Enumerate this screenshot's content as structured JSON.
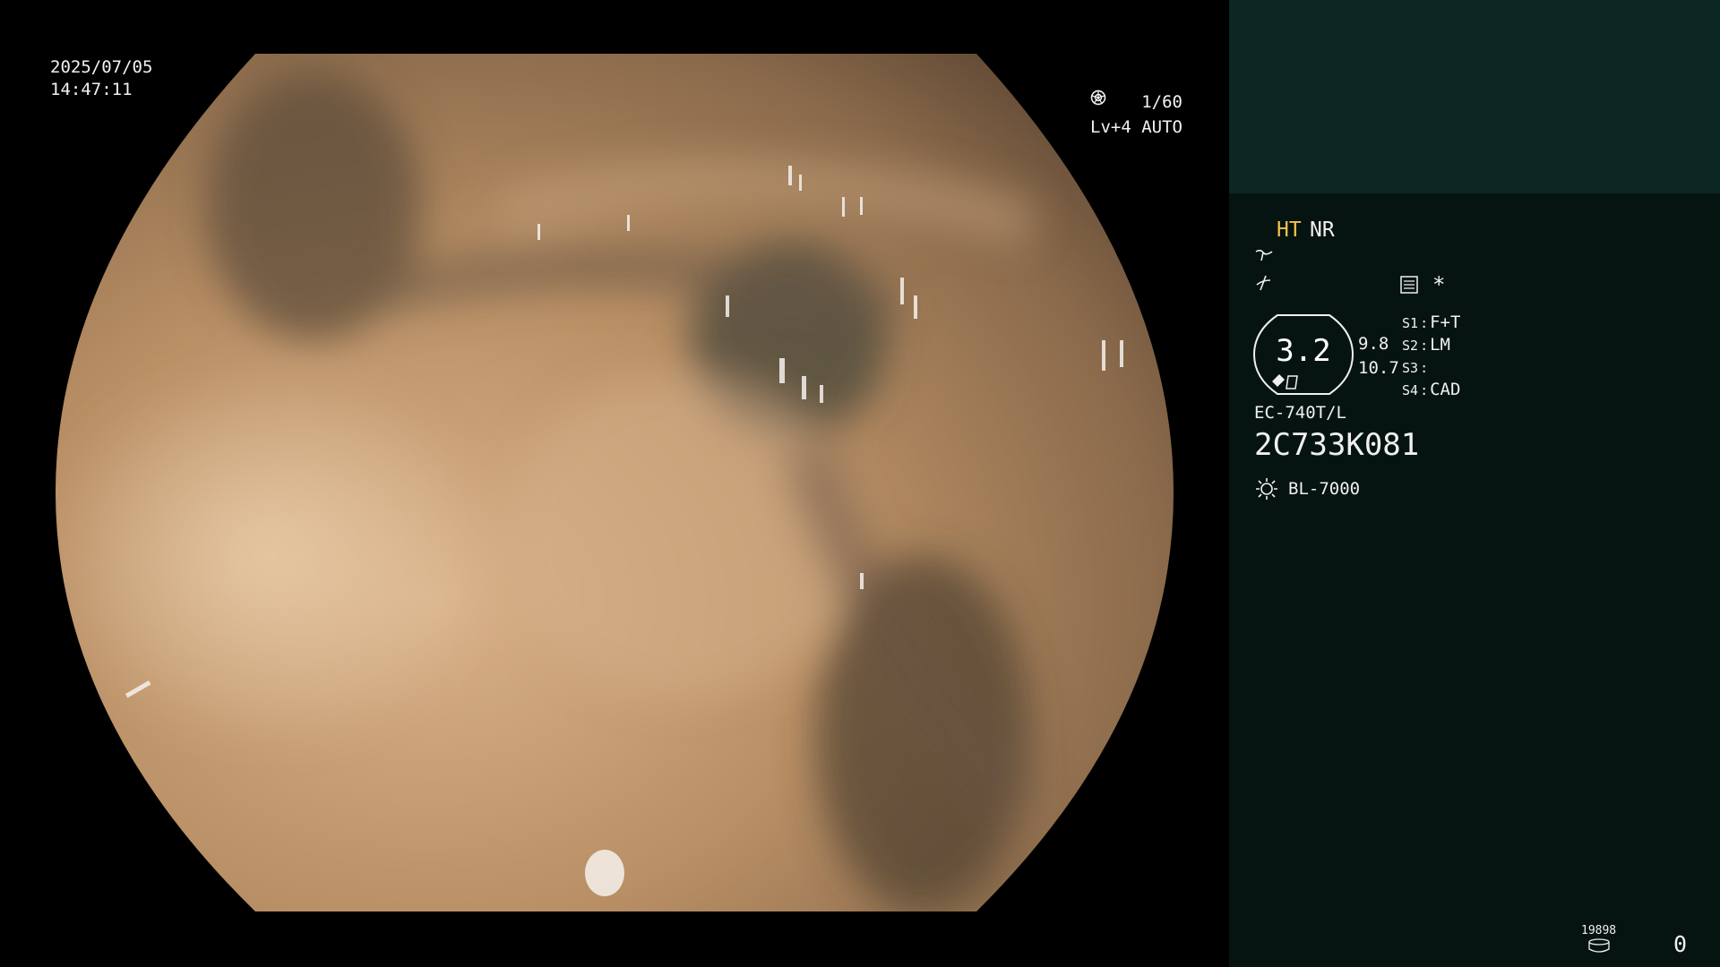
{
  "overlay": {
    "date": "2025/07/05",
    "time": "14:47:11",
    "shutter": "1/60",
    "shutter_icon": "shutter-icon",
    "iris": "Lv+4 AUTO",
    "iris_icon": "auto-iris-icon"
  },
  "panel": {
    "ht": "HT",
    "nr": "NR",
    "ht_color": "#f5c24a",
    "asterisk": "*",
    "zoom": {
      "value": "3.2",
      "scale_a": "9.8",
      "scale_b": "10.7"
    },
    "switches": [
      {
        "key": "S1",
        "value": "F+T"
      },
      {
        "key": "S2",
        "value": "LM"
      },
      {
        "key": "S3",
        "value": ""
      },
      {
        "key": "S4",
        "value": "CAD"
      }
    ],
    "scope_model": "EC-740T/L",
    "serial": "2C733K081",
    "light_source": "BL-7000",
    "light_icon": "light-source-icon",
    "counter_small": "19898",
    "counter": "0"
  },
  "colors": {
    "panel_bg": "#061411",
    "panel_top_bg": "#0c2624",
    "tissue": "#b08a63"
  }
}
